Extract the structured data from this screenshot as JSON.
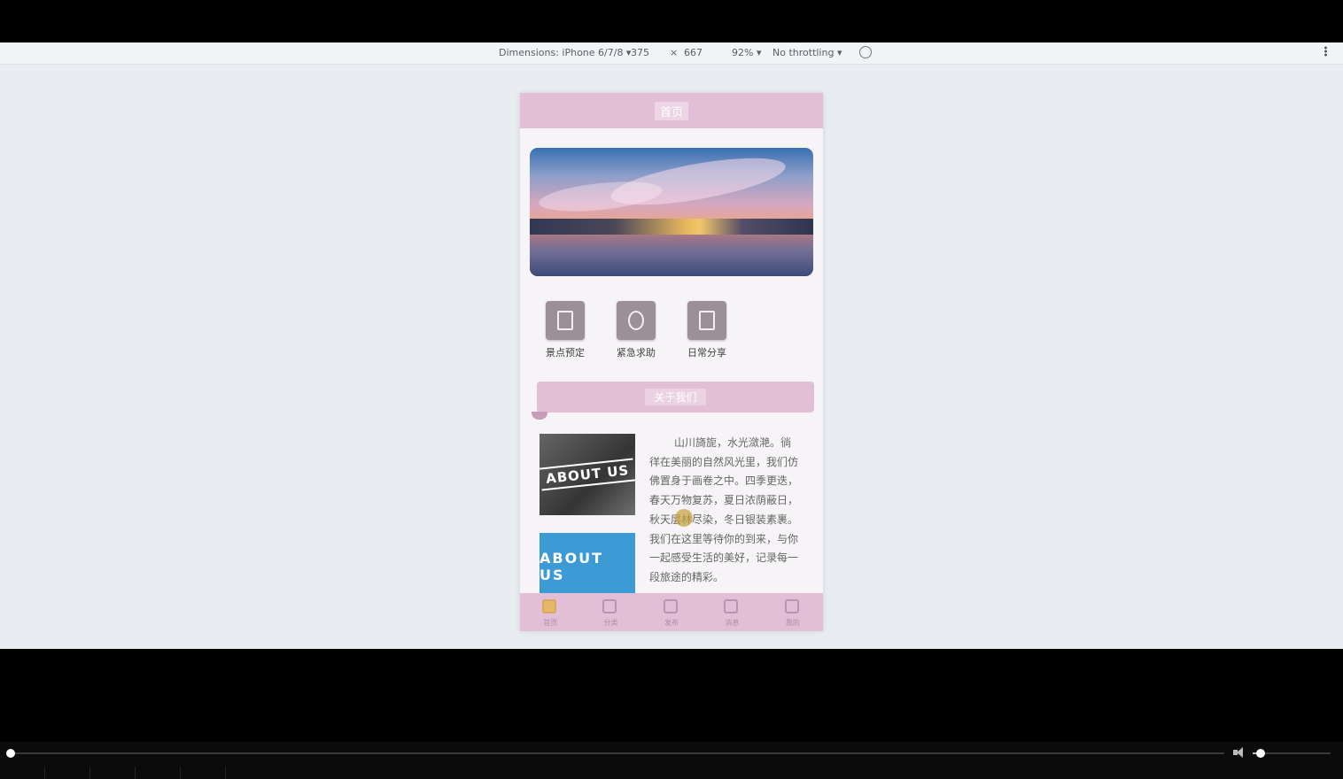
{
  "devtools": {
    "dimensions_label": "Dimensions: iPhone 6/7/8 ▾",
    "width": "375",
    "times": "×",
    "height": "667",
    "zoom": "92% ▾",
    "throttling": "No throttling ▾"
  },
  "phone": {
    "header_title": "首页",
    "quick_links": [
      {
        "label": "景点预定"
      },
      {
        "label": "紧急求助"
      },
      {
        "label": "日常分享"
      }
    ],
    "section_title": "关于我们",
    "about_images": [
      "ABOUT US",
      "ABOUT US"
    ],
    "article_text": "山川旖旎，水光潋滟。徜徉在美丽的自然风光里，我们仿佛置身于画卷之中。四季更迭，春天万物复苏，夏日浓荫蔽日，秋天层林尽染，冬日银装素裹。我们在这里等待你的到来，与你一起感受生活的美好，记录每一段旅途的精彩。",
    "tabs": [
      {
        "label": "首页"
      },
      {
        "label": "分类"
      },
      {
        "label": "发布"
      },
      {
        "label": "消息"
      },
      {
        "label": "我的"
      }
    ]
  },
  "player": {
    "progress": 0.0,
    "volume": 0.1
  },
  "colors": {
    "accent_pink": "#e3bfd7",
    "viewer_bg": "#e9edf2",
    "active_tab": "#e7b650"
  }
}
